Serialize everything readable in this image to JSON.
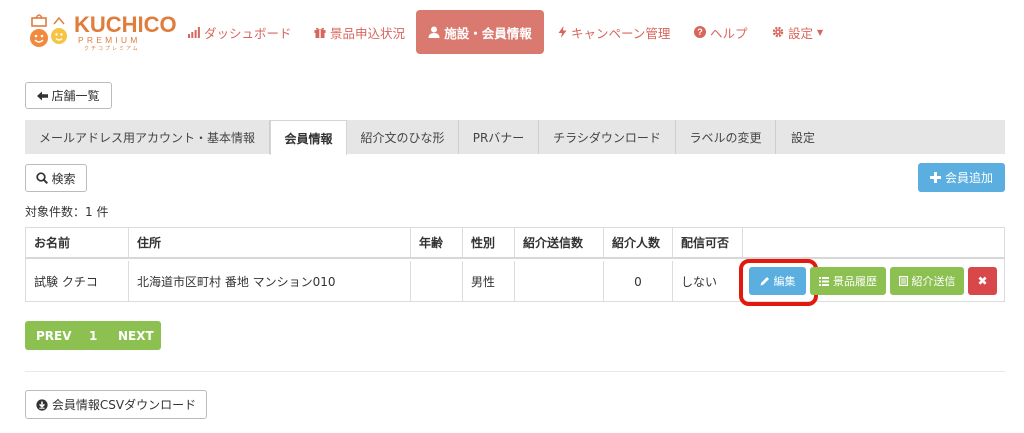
{
  "brand": {
    "name": "KUCHICO",
    "sub": "PREMIUM",
    "kana": "クチコプレミアム"
  },
  "nav": {
    "items": [
      {
        "label": "ダッシュボード",
        "icon": "bar-chart-icon"
      },
      {
        "label": "景品申込状況",
        "icon": "gift-icon"
      },
      {
        "label": "施設・会員情報",
        "icon": "user-icon",
        "active": true
      },
      {
        "label": "キャンペーン管理",
        "icon": "bolt-icon"
      },
      {
        "label": "ヘルプ",
        "icon": "question-icon"
      },
      {
        "label": "設定",
        "icon": "gear-icon"
      }
    ]
  },
  "back_button": {
    "label": "店舗一覧",
    "icon": "arrow-left-icon"
  },
  "tabs": [
    {
      "label": "メールアドレス用アカウント・基本情報"
    },
    {
      "label": "会員情報",
      "active": true
    },
    {
      "label": "紹介文のひな形"
    },
    {
      "label": "PRバナー"
    },
    {
      "label": "チラシダウンロード"
    },
    {
      "label": "ラベルの変更"
    },
    {
      "label": "設定"
    }
  ],
  "search_button": {
    "label": "検索",
    "icon": "search-icon"
  },
  "add_member_button": {
    "label": "会員追加",
    "icon": "plus-icon"
  },
  "result_count": "対象件数：1 件",
  "table": {
    "headers": [
      "お名前",
      "住所",
      "年齢",
      "性別",
      "紹介送信数",
      "紹介人数",
      "配信可否"
    ],
    "rows": [
      {
        "name": "試験 クチコ",
        "address": "北海道市区町村 番地 マンション010",
        "age": "",
        "gender": "男性",
        "sent_count": "",
        "referral_count": "0",
        "delivery": "しない",
        "actions": {
          "edit": "編集",
          "prize_history": "景品履歴",
          "send_referral": "紹介送信",
          "delete": "✖"
        }
      }
    ]
  },
  "pagination": {
    "prev": "PREV",
    "page": "1",
    "next": "NEXT"
  },
  "csv_button": {
    "label": "会員情報CSVダウンロード",
    "icon": "download-icon"
  },
  "colors": {
    "accent": "#d9665c",
    "nav_active_bg": "#d9796f",
    "primary_blue": "#5aaee0",
    "green": "#8cc152",
    "danger": "#d8484a",
    "highlight_red": "#e3190f",
    "logo_orange": "#e07c3c"
  }
}
